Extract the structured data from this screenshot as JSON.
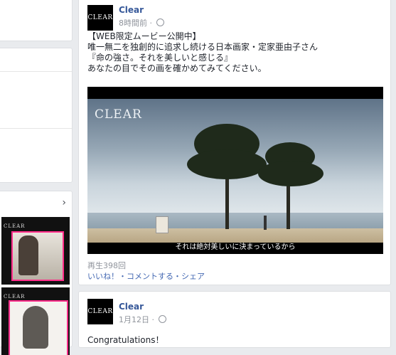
{
  "sidebar": {
    "chevron": "›",
    "thumbs": [
      {
        "brand": "CLEAR"
      },
      {
        "brand": "CLEAR"
      }
    ]
  },
  "posts": [
    {
      "page_name": "Clear",
      "avatar_text": "CLEAR",
      "time": "8時間前",
      "dot": "·",
      "body_lines": [
        "【WEB限定ムービー公開中】",
        "唯一無二を独創的に追求し続ける日本画家・定家亜由子さん",
        "『命の強さ。それを美しいと感じる』",
        "あなたの目でその画を確かめてみてください。"
      ],
      "video": {
        "logo": "CLEAR",
        "subtitle": "それは絶対美しいに決まっているから"
      },
      "views": "再生398回",
      "actions": "いいね！・コメントする・シェア"
    },
    {
      "page_name": "Clear",
      "avatar_text": "CLEAR",
      "time": "1月12日",
      "dot": "·",
      "body_lines": [
        "Congratulations！"
      ]
    }
  ]
}
